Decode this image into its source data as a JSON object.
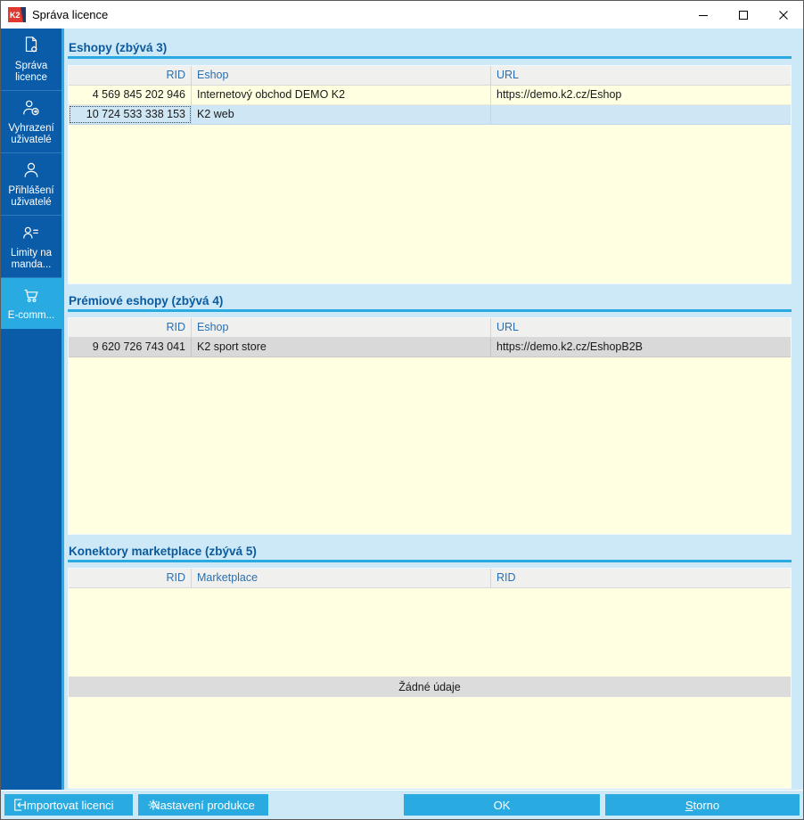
{
  "window": {
    "title": "Správa licence",
    "logo_text": "K2"
  },
  "sidebar": {
    "items": [
      {
        "line1": "Správa",
        "line2": "licence",
        "icon": "license-document-icon",
        "selected": false
      },
      {
        "line1": "Vyhrazení",
        "line2": "uživatelé",
        "icon": "user-arrow-icon",
        "selected": false
      },
      {
        "line1": "Přihlášení",
        "line2": "uživatelé",
        "icon": "user-icon",
        "selected": false
      },
      {
        "line1": "Limity na",
        "line2": "manda...",
        "icon": "user-list-icon",
        "selected": false
      },
      {
        "line1": "E-comm...",
        "line2": "",
        "icon": "cart-icon",
        "selected": true
      }
    ]
  },
  "sections": [
    {
      "title": "Eshopy (zbývá 3)",
      "columns": [
        "RID",
        "Eshop",
        "URL"
      ],
      "rows": [
        {
          "rid": "4 569 845 202 946",
          "name": "Internetový obchod DEMO K2",
          "url": "https://demo.k2.cz/Eshop"
        },
        {
          "rid": "10 724 533 338 153",
          "name": "K2 web",
          "url": ""
        }
      ]
    },
    {
      "title": "Prémiové eshopy (zbývá 4)",
      "columns": [
        "RID",
        "Eshop",
        "URL"
      ],
      "rows": [
        {
          "rid": "9 620 726 743 041",
          "name": "K2 sport store",
          "url": "https://demo.k2.cz/EshopB2B"
        }
      ]
    },
    {
      "title": "Konektory marketplace (zbývá 5)",
      "columns": [
        "RID",
        "Marketplace",
        "RID"
      ],
      "rows": [],
      "empty_text": "Žádné údaje"
    }
  ],
  "footer": {
    "import_label": "Importovat licenci",
    "settings_label": "Nastavení produkce",
    "ok_label": "OK",
    "storno_first": "S",
    "storno_rest": "torno"
  },
  "colors": {
    "sidebar_blue": "#0a5ca8",
    "accent_cyan": "#29abe2",
    "content_bg": "#cde9f8",
    "table_bg": "#ffffe1",
    "selected_row": "#cfe6f5",
    "inactive_row": "#d9d9d9",
    "section_title": "#0b5a9d"
  }
}
